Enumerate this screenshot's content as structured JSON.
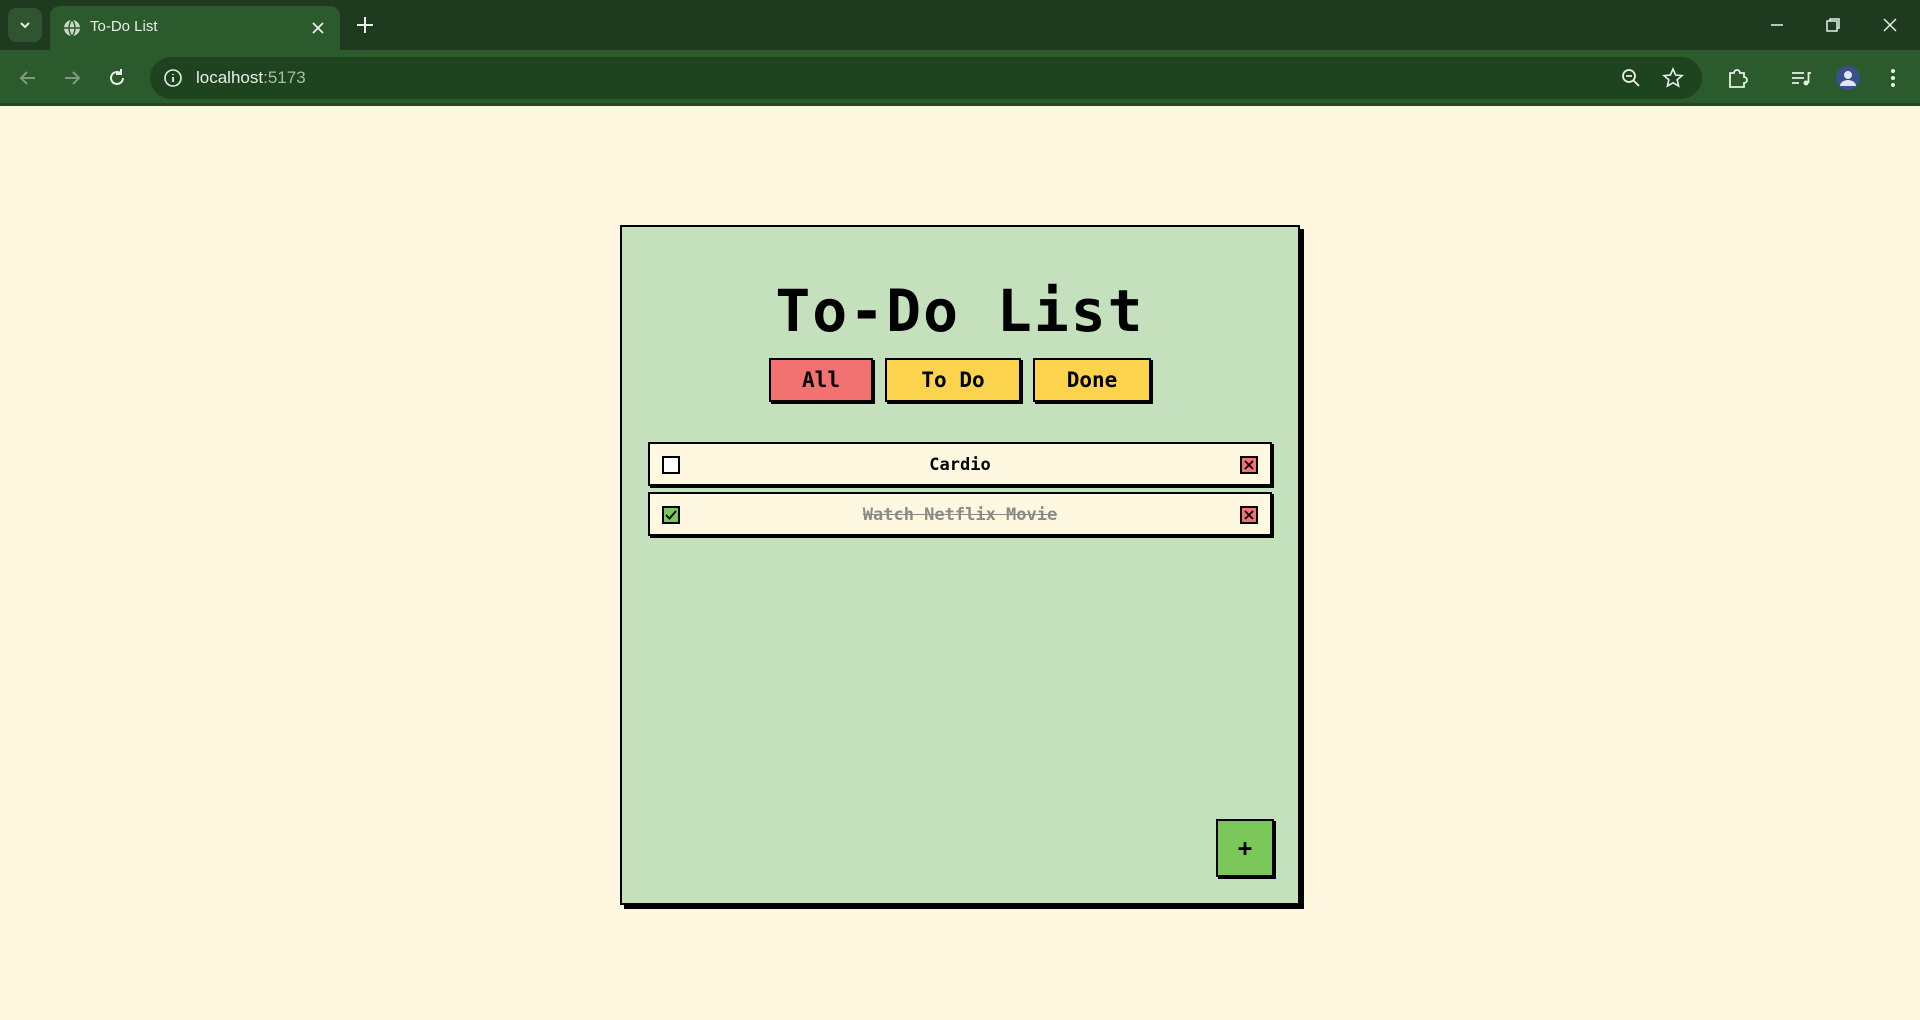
{
  "browser": {
    "tab_title": "To-Do List",
    "url_host": "localhost",
    "url_port": ":5173"
  },
  "app": {
    "title": "To-Do List",
    "filters": [
      {
        "label": "All",
        "active": true
      },
      {
        "label": "To Do",
        "active": false
      },
      {
        "label": "Done",
        "active": false
      }
    ],
    "tasks": [
      {
        "text": "Cardio",
        "done": false
      },
      {
        "text": "Watch Netflix Movie",
        "done": true
      }
    ],
    "add_label": "+"
  },
  "colors": {
    "page_bg": "#fff8e1",
    "card_bg": "#c5e0bd",
    "active_filter": "#f27272",
    "inactive_filter": "#fcd34d",
    "checked": "#7bc75a",
    "delete": "#f27272",
    "chrome": "#1e3a1f"
  }
}
